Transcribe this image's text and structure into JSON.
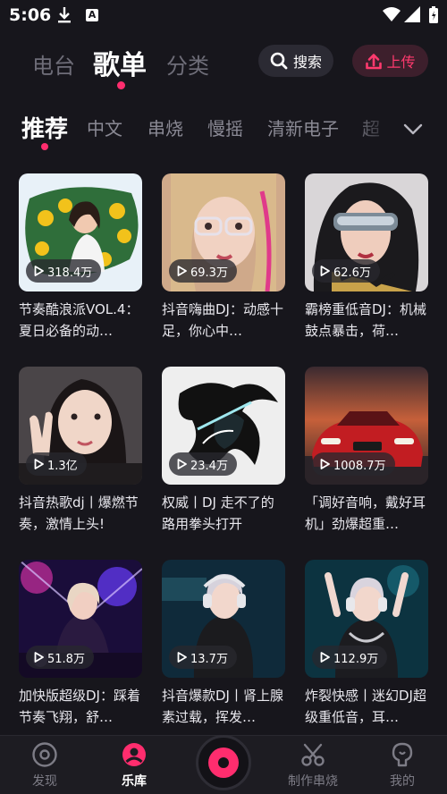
{
  "status_bar": {
    "time": "5:06",
    "icons": [
      "download-icon",
      "a-notification-icon",
      "wifi-icon",
      "signal-icon",
      "battery-charging-icon"
    ]
  },
  "header": {
    "tabs": [
      {
        "label": "电台",
        "active": false
      },
      {
        "label": "歌单",
        "active": true
      },
      {
        "label": "分类",
        "active": false
      }
    ],
    "search_label": "搜索",
    "upload_label": "上传",
    "accent_color": "#ff2d6e"
  },
  "subtabs": {
    "items": [
      "推荐",
      "中文",
      "串烧",
      "慢摇",
      "清新电子",
      "超"
    ],
    "active_index": 0
  },
  "playlists": [
    {
      "plays": "318.4万",
      "title": "节奏酷浪派VOL.4：夏日必备的动…"
    },
    {
      "plays": "69.3万",
      "title": "抖音嗨曲DJ：动感十足，你心中…"
    },
    {
      "plays": "62.6万",
      "title": "霸榜重低音DJ：机械鼓点暴击，荷…"
    },
    {
      "plays": "1.3亿",
      "title": "抖音热歌dj丨爆燃节奏，激情上头!"
    },
    {
      "plays": "23.4万",
      "title": "权威丨DJ 走不了的路用拳头打开"
    },
    {
      "plays": "1008.7万",
      "title": "「调好音响，戴好耳机」劲爆超重…"
    },
    {
      "plays": "51.8万",
      "title": "加快版超级DJ：踩着节奏飞翔，舒…"
    },
    {
      "plays": "13.7万",
      "title": "抖音爆款DJ丨肾上腺素过载，挥发…"
    },
    {
      "plays": "112.9万",
      "title": "炸裂快感丨迷幻DJ超级重低音，耳…"
    }
  ],
  "bottom_nav": {
    "items": [
      {
        "label": "发现",
        "icon": "disc-icon",
        "active": false
      },
      {
        "label": "乐库",
        "icon": "library-person-icon",
        "active": true
      },
      {
        "label": "制作串烧",
        "icon": "scissors-icon",
        "active": false
      },
      {
        "label": "我的",
        "icon": "profile-head-icon",
        "active": false
      }
    ],
    "center_button": "record-icon"
  }
}
